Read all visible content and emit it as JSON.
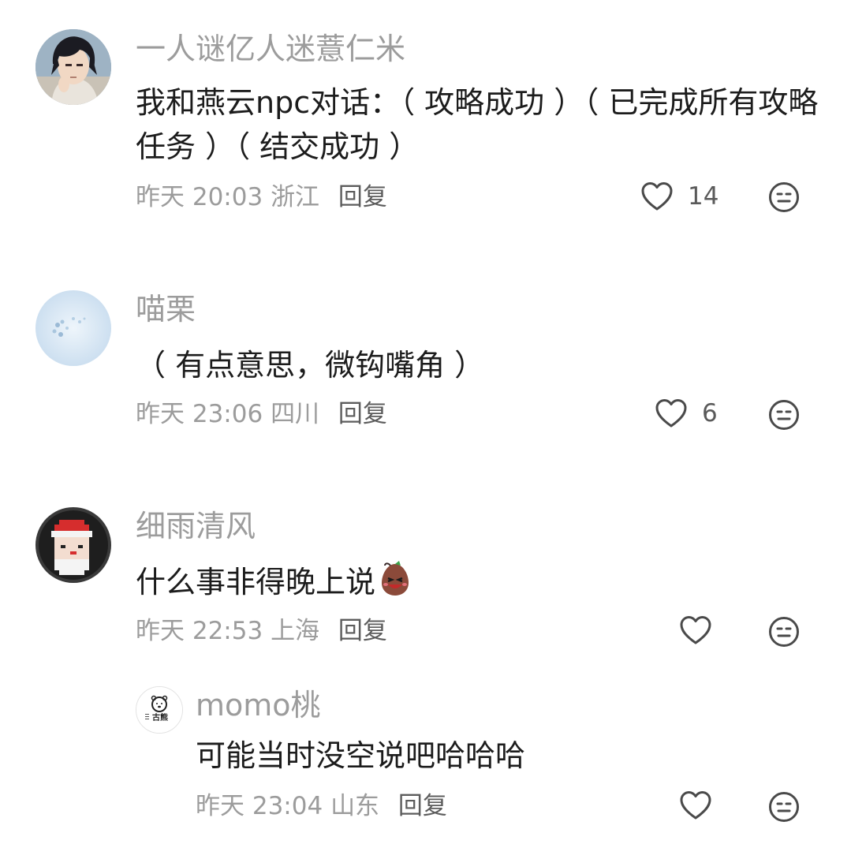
{
  "comments": [
    {
      "username": "一人谜亿人迷薏仁米",
      "content": "我和燕云npc对话：（ 攻略成功 ）（ 已完成所有攻略任务 ）（ 结交成功 ）",
      "date": "昨天",
      "time": "20:03",
      "location": "浙江",
      "reply_label": "回复",
      "likes": "14",
      "avatar_icon": "anime-boy-avatar-icon"
    },
    {
      "username": "喵栗",
      "content": "（ 有点意思，微钩嘴角 ）",
      "date": "昨天",
      "time": "23:06",
      "location": "四川",
      "reply_label": "回复",
      "likes": "6",
      "avatar_icon": "snow-flower-avatar-icon"
    },
    {
      "username": "细雨清风",
      "content": "什么事非得晚上说",
      "content_emoji": "grinning-bean-emoji",
      "date": "昨天",
      "time": "22:53",
      "location": "上海",
      "reply_label": "回复",
      "likes": "",
      "avatar_icon": "pixel-santa-avatar-icon"
    }
  ],
  "replies": [
    {
      "username": "momo桃",
      "content": "可能当时没空说吧哈哈哈",
      "date": "昨天",
      "time": "23:04",
      "location": "山东",
      "reply_label": "回复",
      "likes": "",
      "avatar_icon": "bear-logo-avatar-icon",
      "avatar_text": "古熊"
    }
  ],
  "colors": {
    "username": "#9c9c9c",
    "content": "#1c1c1c",
    "meta": "#9c9c9c",
    "icon": "#4a4a4a"
  }
}
